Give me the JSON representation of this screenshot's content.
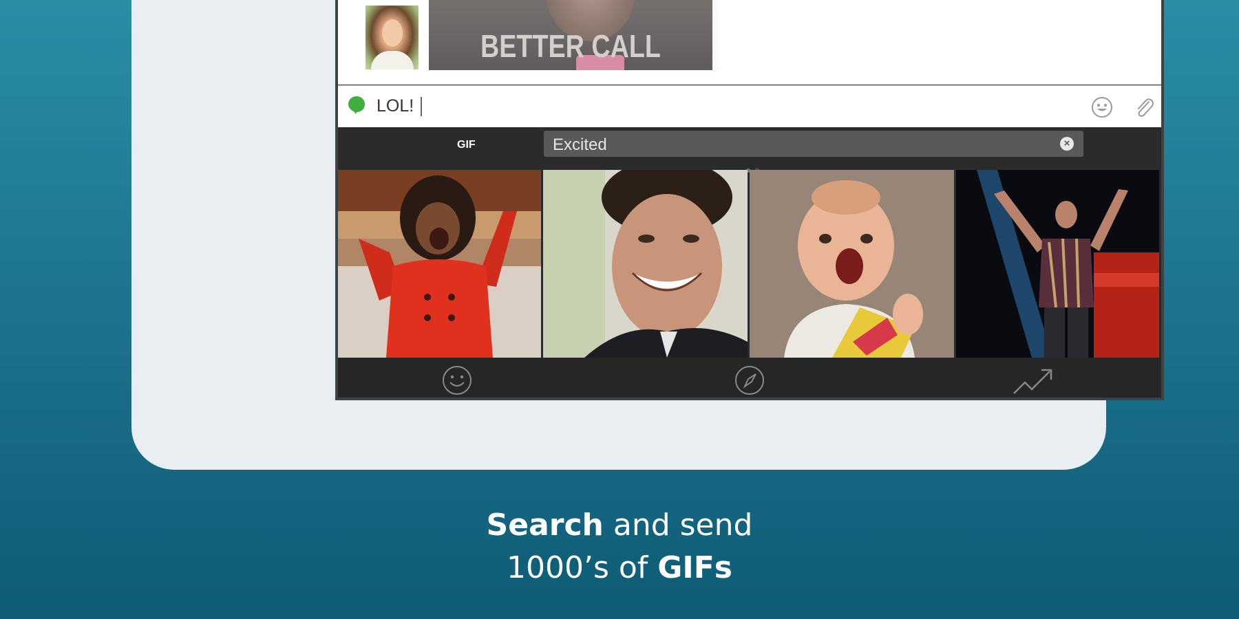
{
  "chat": {
    "gif_caption": "BETTER CALL SAUL"
  },
  "composer": {
    "text": "LOL!",
    "emoji_icon": "smiley-icon",
    "attach_icon": "paperclip-icon"
  },
  "keyboard": {
    "logo": "GIF",
    "search_value": "Excited",
    "clear_icon": "clear-icon",
    "gif_tiles": [
      "oprah-excited-gif",
      "james-franco-smiling-gif",
      "excited-baby-gif",
      "singer-celebrating-gif"
    ],
    "tabs": [
      "smiley-icon",
      "compass-icon",
      "trending-icon"
    ]
  },
  "headline": {
    "line1_bold": "Search",
    "line1_rest": " and send",
    "line2_start": "1000’s of ",
    "line2_bold": "GIFs"
  },
  "colors": {
    "accent_green": "#3fae3f",
    "background_teal": "#1f7590"
  }
}
